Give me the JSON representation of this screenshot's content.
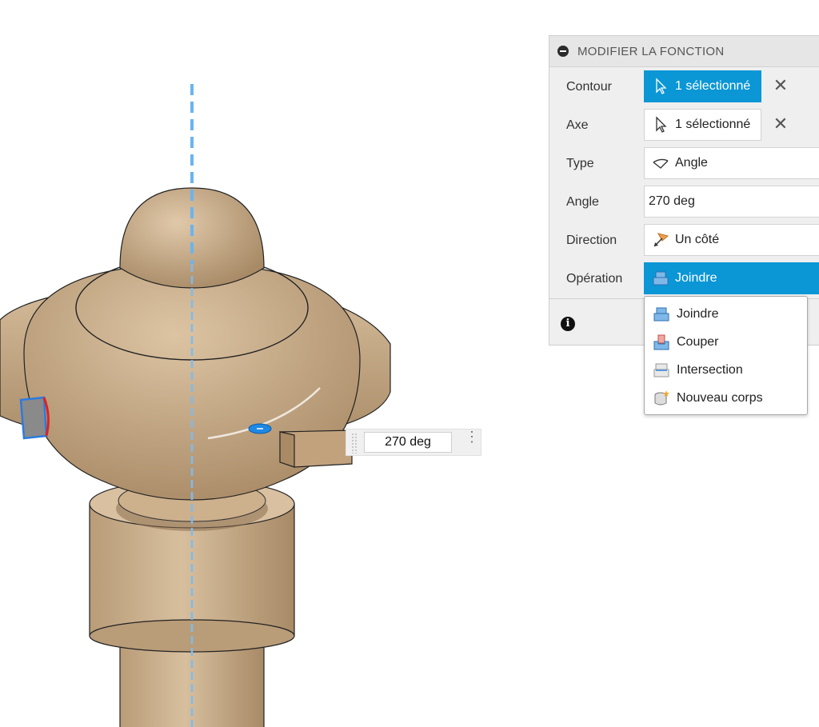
{
  "panel": {
    "title": "MODIFIER LA FONCTION",
    "rows": [
      {
        "label": "Contour",
        "value": "1 sélectionné",
        "icon": "cursor-select-icon"
      },
      {
        "label": "Axe",
        "value": "1 sélectionné",
        "icon": "cursor-select-icon"
      },
      {
        "label": "Type",
        "value": "Angle",
        "icon": "angle-type-icon"
      },
      {
        "label": "Angle",
        "value": "270 deg"
      },
      {
        "label": "Direction",
        "value": "Un côté",
        "icon": "one-side-direction-icon"
      },
      {
        "label": "Opération",
        "value": "Joindre",
        "icon": "join-operation-icon"
      }
    ],
    "clear_symbol": "✕",
    "info_symbol": "i"
  },
  "operation_menu": {
    "items": [
      {
        "label": "Joindre",
        "icon": "join-icon"
      },
      {
        "label": "Couper",
        "icon": "cut-icon"
      },
      {
        "label": "Intersection",
        "icon": "intersect-icon"
      },
      {
        "label": "Nouveau corps",
        "icon": "new-body-icon"
      }
    ]
  },
  "viewport": {
    "dimension_value": "270 deg",
    "dimension_menu_symbol": "⋮"
  },
  "colors": {
    "accent": "#0b96d6",
    "wood": "#c9ad8a",
    "axis": "#6ab4f0"
  }
}
